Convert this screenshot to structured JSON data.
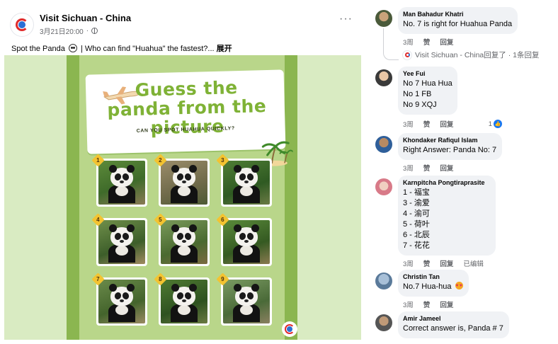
{
  "post": {
    "page_name": "Visit Sichuan - China",
    "timestamp": "3月21日20:00",
    "meta_separator": "·",
    "caption_before": "Spot the Panda",
    "caption_after": "| Who can find \"Huahua\" the fastest?...",
    "expand_label": "展开",
    "more_icon": "more-horizontal-icon",
    "poster": {
      "title": "Guess the panda from the picture",
      "subtitle": "CAN YOU SPOT HUAHUA QUICKLY?",
      "tile_numbers": [
        "1",
        "2",
        "3",
        "4",
        "5",
        "6",
        "7",
        "8",
        "9"
      ]
    }
  },
  "comments": [
    {
      "name": "Man Bahadur Khatri",
      "lines": [
        "No. 7 is right for Huahua Panda"
      ],
      "time": "3周",
      "like": "赞",
      "reply": "回复",
      "replies_summary": "Visit Sichuan - China回复了 · 1条回复"
    },
    {
      "name": "Yee Fui",
      "lines": [
        "No 7 Hua Hua",
        "No 1 FB",
        "No 9 XQJ"
      ],
      "time": "3周",
      "like": "赞",
      "reply": "回复",
      "like_count": "1"
    },
    {
      "name": "Khondaker Rafiqul Islam",
      "lines": [
        "Right Answer: Panda No: 7"
      ],
      "time": "3周",
      "like": "赞",
      "reply": "回复"
    },
    {
      "name": "Karnpitcha Pongtiraprasite",
      "lines": [
        "1 - 福宝",
        "3 - 渝爱",
        "4 - 渝可",
        "5 - 荷叶",
        "6 - 北辰",
        "7 - 花花"
      ],
      "time": "3周",
      "like": "赞",
      "reply": "回复",
      "edited": "已编辑"
    },
    {
      "name": "Christin Tan",
      "lines": [
        "No.7 Hua-hua"
      ],
      "time": "3周",
      "like": "赞",
      "reply": "回复"
    },
    {
      "name": "Amir Jameel",
      "lines": [
        "Correct answer is, Panda # 7"
      ]
    }
  ],
  "colors": {
    "poster_bg": "#d9ebc2",
    "poster_green": "#8bb650",
    "title_green": "#7fb236",
    "like_blue": "#1877f2",
    "bubble_gray": "#f0f2f5"
  }
}
